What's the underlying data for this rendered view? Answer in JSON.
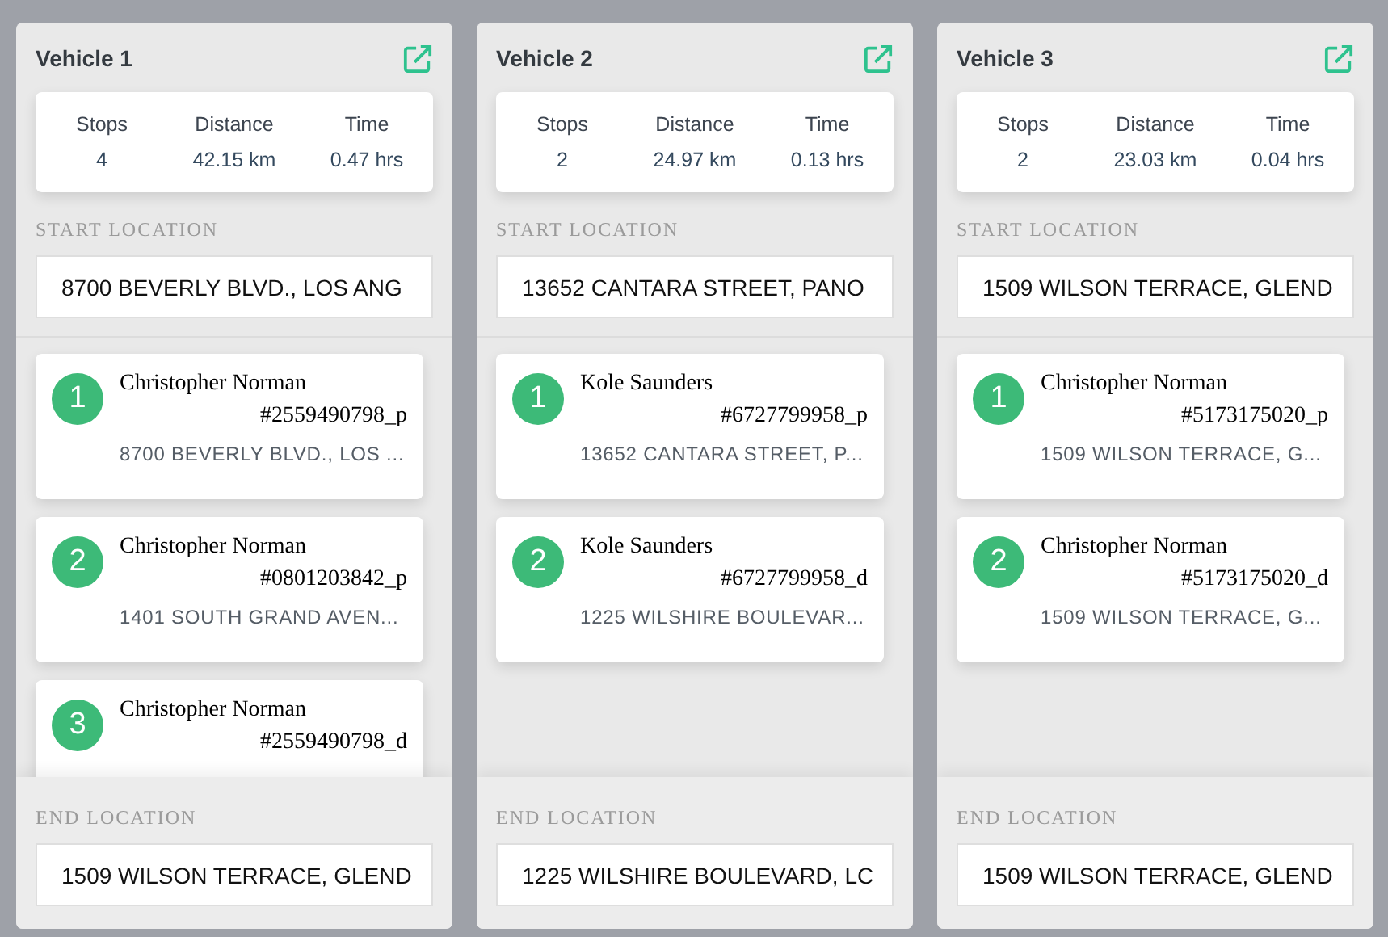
{
  "vehicles": [
    {
      "title": "Vehicle 1",
      "stats": [
        {
          "label": "Stops",
          "value": "4"
        },
        {
          "label": "Distance",
          "value": "42.15 km"
        },
        {
          "label": "Time",
          "value": "0.47 hrs"
        }
      ],
      "start_label": "START LOCATION",
      "start_location": "8700 BEVERLY BLVD., LOS ANG",
      "stops": [
        {
          "number": "1",
          "name": "Christopher Norman",
          "order_id": "#2559490798_p",
          "address": "8700 BEVERLY BLVD., LOS ..."
        },
        {
          "number": "2",
          "name": "Christopher Norman",
          "order_id": "#0801203842_p",
          "address": "1401 SOUTH GRAND AVEN..."
        },
        {
          "number": "3",
          "name": "Christopher Norman",
          "order_id": "#2559490798_d"
        }
      ],
      "end_label": "END LOCATION",
      "end_location": "1509 WILSON TERRACE, GLEND"
    },
    {
      "title": "Vehicle 2",
      "stats": [
        {
          "label": "Stops",
          "value": "2"
        },
        {
          "label": "Distance",
          "value": "24.97 km"
        },
        {
          "label": "Time",
          "value": "0.13 hrs"
        }
      ],
      "start_label": "START LOCATION",
      "start_location": "13652 CANTARA STREET, PANO",
      "stops": [
        {
          "number": "1",
          "name": "Kole Saunders",
          "order_id": "#6727799958_p",
          "address": "13652 CANTARA STREET, P..."
        },
        {
          "number": "2",
          "name": "Kole Saunders",
          "order_id": "#6727799958_d",
          "address": "1225 WILSHIRE BOULEVAR..."
        }
      ],
      "end_label": "END LOCATION",
      "end_location": "1225 WILSHIRE BOULEVARD, LC"
    },
    {
      "title": "Vehicle 3",
      "stats": [
        {
          "label": "Stops",
          "value": "2"
        },
        {
          "label": "Distance",
          "value": "23.03 km"
        },
        {
          "label": "Time",
          "value": "0.04 hrs"
        }
      ],
      "start_label": "START LOCATION",
      "start_location": "1509 WILSON TERRACE, GLEND",
      "stops": [
        {
          "number": "1",
          "name": "Christopher Norman",
          "order_id": "#5173175020_p",
          "address": "1509 WILSON TERRACE, G..."
        },
        {
          "number": "2",
          "name": "Christopher Norman",
          "order_id": "#5173175020_d",
          "address": "1509 WILSON TERRACE, G..."
        }
      ],
      "end_label": "END LOCATION",
      "end_location": "1509 WILSON TERRACE, GLEND"
    }
  ]
}
